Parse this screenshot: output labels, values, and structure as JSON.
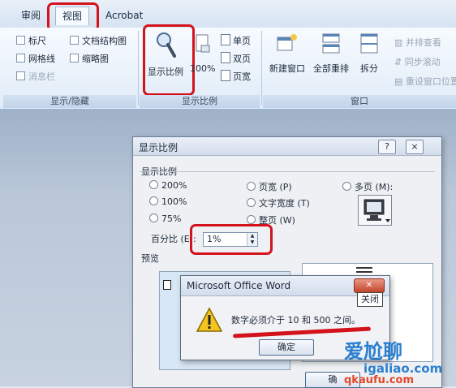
{
  "tabs": {
    "review": "审阅",
    "view": "视图",
    "acrobat": "Acrobat"
  },
  "ribbon": {
    "show_hide": {
      "ruler": "标尺",
      "doc_map": "文档结构图",
      "gridlines": "网格线",
      "thumbnails": "缩略图",
      "message_bar": "消息栏",
      "group_label": "显示/隐藏"
    },
    "zoom": {
      "zoom_button": "显示比例",
      "hundred": "100%",
      "one_page": "单页",
      "two_pages": "双页",
      "page_width": "页宽",
      "group_label": "显示比例"
    },
    "window": {
      "new_window": "新建窗口",
      "arrange_all": "全部重排",
      "split": "拆分",
      "side_by_side": "并排查看",
      "sync_scroll": "同步滚动",
      "reset_position": "重设窗口位置",
      "group_label": "窗口"
    }
  },
  "zoom_dialog": {
    "title": "显示比例",
    "help": "?",
    "close": "×",
    "section_zoom": "显示比例",
    "opt_200": "200%",
    "opt_100": "100%",
    "opt_75": "75%",
    "opt_page_width": "页宽 (P)",
    "opt_text_width": "文字宽度 (T)",
    "opt_whole_page": "整页 (W)",
    "opt_many_pages": "多页 (M):",
    "percent_label": "百分比 (E):",
    "percent_value": "1%",
    "section_preview": "预览",
    "ok_partial": "确"
  },
  "message_box": {
    "title": "Microsoft Office Word",
    "close_label": "关闭",
    "text": "数字必须介于 10 和 500 之间。",
    "ok": "确定"
  },
  "watermark": {
    "line1": "爱尬聊",
    "line2": "igaliao.com",
    "line3": "qkaufu.com"
  },
  "colors": {
    "highlight": "#d4121c",
    "ribbon": "#e0ebf7"
  }
}
